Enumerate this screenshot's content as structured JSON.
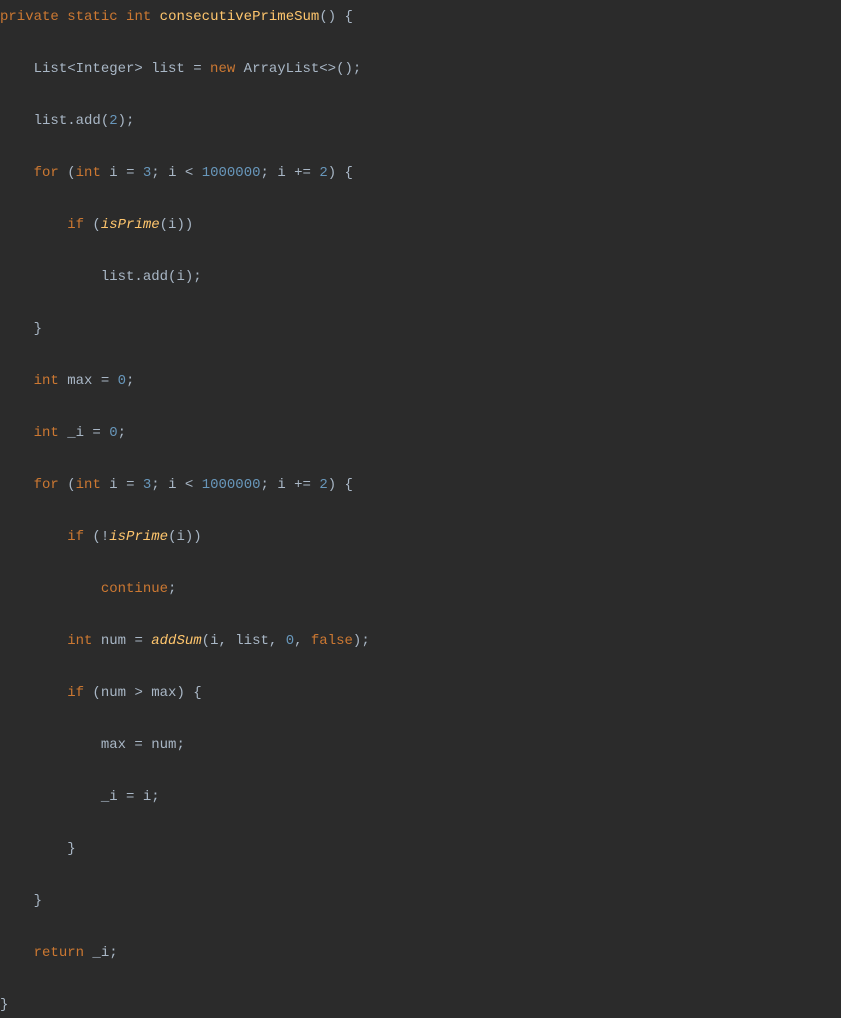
{
  "code": {
    "line1": {
      "kw1": "private",
      "kw2": "static",
      "kw3": "int",
      "method": "consecutivePrimeSum",
      "rest": "() {"
    },
    "line2": {
      "text1": "List<Integer> list = ",
      "kw": "new",
      "text2": " ArrayList<>();"
    },
    "line3": {
      "text1": "list.add(",
      "num": "2",
      "text2": ");"
    },
    "line4": {
      "kw1": "for",
      "text1": " (",
      "kw2": "int",
      "text2": " i = ",
      "num1": "3",
      "text3": "; i < ",
      "num2": "1000000",
      "text4": "; i += ",
      "num3": "2",
      "text5": ") {"
    },
    "line5": {
      "kw": "if",
      "text1": " (",
      "method": "isPrime",
      "text2": "(i))"
    },
    "line6": {
      "text": "list.add(i);"
    },
    "line7": {
      "text": "}"
    },
    "line8": {
      "kw": "int",
      "text1": " max = ",
      "num": "0",
      "text2": ";"
    },
    "line9": {
      "kw": "int",
      "text1": " _i = ",
      "num": "0",
      "text2": ";"
    },
    "line10": {
      "kw1": "for",
      "text1": " (",
      "kw2": "int",
      "text2": " i = ",
      "num1": "3",
      "text3": "; i < ",
      "num2": "1000000",
      "text4": "; i += ",
      "num3": "2",
      "text5": ") {"
    },
    "line11": {
      "kw": "if",
      "text1": " (!",
      "method": "isPrime",
      "text2": "(i))"
    },
    "line12": {
      "kw": "continue",
      "text": ";"
    },
    "line13": {
      "kw": "int",
      "text1": " num = ",
      "method": "addSum",
      "text2": "(i, list, ",
      "num": "0",
      "text3": ", ",
      "kw2": "false",
      "text4": ");"
    },
    "line14": {
      "kw": "if",
      "text": " (num > max) {"
    },
    "line15": {
      "text": "max = num;"
    },
    "line16": {
      "text": "_i = i;"
    },
    "line17": {
      "text": "}"
    },
    "line18": {
      "text": "}"
    },
    "line19": {
      "kw": "return",
      "text": " _i;"
    },
    "line20": {
      "text": "}"
    }
  }
}
